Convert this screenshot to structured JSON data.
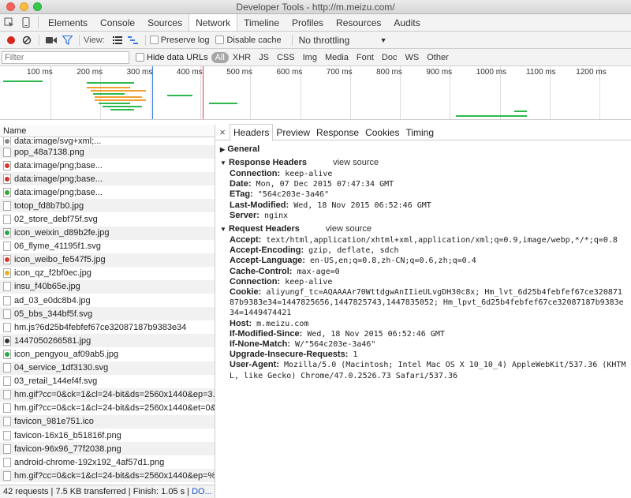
{
  "window": {
    "title": "Developer Tools - http://m.meizu.com/"
  },
  "tabs": [
    "Elements",
    "Console",
    "Sources",
    "Network",
    "Timeline",
    "Profiles",
    "Resources",
    "Audits"
  ],
  "toolbar": {
    "view_label": "View:",
    "preserve_log": "Preserve log",
    "disable_cache": "Disable cache",
    "throttling": "No throttling"
  },
  "filterbar": {
    "placeholder": "Filter",
    "hide_data_urls": "Hide data URLs",
    "types": [
      "All",
      "XHR",
      "JS",
      "CSS",
      "Img",
      "Media",
      "Font",
      "Doc",
      "WS",
      "Other"
    ]
  },
  "overview": {
    "ticks": [
      "100 ms",
      "200 ms",
      "300 ms",
      "400 ms",
      "500 ms",
      "600 ms",
      "700 ms",
      "800 ms",
      "900 ms",
      "1000 ms",
      "1100 ms",
      "1200 ms"
    ]
  },
  "request_list": {
    "header": "Name",
    "rows": [
      {
        "name": "data:image/svg+xml;...",
        "icon": "svg"
      },
      {
        "name": "pop_48a7138.png",
        "icon": "file"
      },
      {
        "name": "data:image/png;base...",
        "icon": "red-dot"
      },
      {
        "name": "data:image/png;base...",
        "icon": "flag"
      },
      {
        "name": "data:image/png;base...",
        "icon": "stripe"
      },
      {
        "name": "totop_fd8b7b0.jpg",
        "icon": "file"
      },
      {
        "name": "02_store_debf75f.svg",
        "icon": "file"
      },
      {
        "name": "icon_weixin_d89b2fe.jpg",
        "icon": "green-dot"
      },
      {
        "name": "06_flyme_41195f1.svg",
        "icon": "file"
      },
      {
        "name": "icon_weibo_fe547f5.jpg",
        "icon": "red-dot"
      },
      {
        "name": "icon_qz_f2bf0ec.jpg",
        "icon": "yellow-dot"
      },
      {
        "name": "insu_f40b65e.jpg",
        "icon": "file"
      },
      {
        "name": "ad_03_e0dc8b4.jpg",
        "icon": "file"
      },
      {
        "name": "05_bbs_344bf5f.svg",
        "icon": "file"
      },
      {
        "name": "hm.js?6d25b4febfef67ce32087187b9383e34",
        "icon": "file"
      },
      {
        "name": "1447050266581.jpg",
        "icon": "dark"
      },
      {
        "name": "icon_pengyou_af09ab5.jpg",
        "icon": "green-dot"
      },
      {
        "name": "04_service_1df3130.svg",
        "icon": "file"
      },
      {
        "name": "03_retail_144ef4f.svg",
        "icon": "file"
      },
      {
        "name": "hm.gif?cc=0&ck=1&cl=24-bit&ds=2560x1440&ep=3...",
        "icon": "file"
      },
      {
        "name": "hm.gif?cc=0&ck=1&cl=24-bit&ds=2560x1440&et=0&...",
        "icon": "file"
      },
      {
        "name": "favicon_981e751.ico",
        "icon": "file"
      },
      {
        "name": "favicon-16x16_b51816f.png",
        "icon": "file"
      },
      {
        "name": "favicon-96x96_77f2038.png",
        "icon": "file"
      },
      {
        "name": "android-chrome-192x192_4af57d1.png",
        "icon": "file"
      },
      {
        "name": "hm.gif?cc=0&ck=1&cl=24-bit&ds=2560x1440&ep=%...",
        "icon": "file"
      }
    ]
  },
  "statusbar": {
    "text": "42 requests  |  7.5 KB transferred  |  Finish: 1.05 s  |",
    "dom": "DO..."
  },
  "detail": {
    "tabs": [
      "Headers",
      "Preview",
      "Response",
      "Cookies",
      "Timing"
    ],
    "general_label": "General",
    "response_label": "Response Headers",
    "request_label": "Request Headers",
    "view_source": "view source",
    "response_headers": [
      {
        "k": "Connection:",
        "v": "keep-alive"
      },
      {
        "k": "Date:",
        "v": "Mon, 07 Dec 2015 07:47:34 GMT"
      },
      {
        "k": "ETag:",
        "v": "\"564c203e-3a46\""
      },
      {
        "k": "Last-Modified:",
        "v": "Wed, 18 Nov 2015 06:52:46 GMT"
      },
      {
        "k": "Server:",
        "v": "nginx"
      }
    ],
    "request_headers": [
      {
        "k": "Accept:",
        "v": "text/html,application/xhtml+xml,application/xml;q=0.9,image/webp,*/*;q=0.8"
      },
      {
        "k": "Accept-Encoding:",
        "v": "gzip, deflate, sdch"
      },
      {
        "k": "Accept-Language:",
        "v": "en-US,en;q=0.8,zh-CN;q=0.6,zh;q=0.4"
      },
      {
        "k": "Cache-Control:",
        "v": "max-age=0"
      },
      {
        "k": "Connection:",
        "v": "keep-alive"
      },
      {
        "k": "Cookie:",
        "v": "aliyungf_tc=AQAAAAr70WttdgwAnIIieULvgDH30c8x; Hm_lvt_6d25b4febfef67ce32087187b9383e34=1447825656,1447825743,1447835052; Hm_lpvt_6d25b4febfef67ce32087187b9383e34=1449474421"
      },
      {
        "k": "Host:",
        "v": "m.meizu.com"
      },
      {
        "k": "If-Modified-Since:",
        "v": "Wed, 18 Nov 2015 06:52:46 GMT"
      },
      {
        "k": "If-None-Match:",
        "v": "W/\"564c203e-3a46\""
      },
      {
        "k": "Upgrade-Insecure-Requests:",
        "v": "1"
      },
      {
        "k": "User-Agent:",
        "v": "Mozilla/5.0 (Macintosh; Intel Mac OS X 10_10_4) AppleWebKit/537.36 (KHTML, like Gecko) Chrome/47.0.2526.73 Safari/537.36"
      }
    ]
  },
  "colors": {
    "record": "#d7251d",
    "accent": "#1a4fc2",
    "filter_active": "#3a7de0"
  }
}
